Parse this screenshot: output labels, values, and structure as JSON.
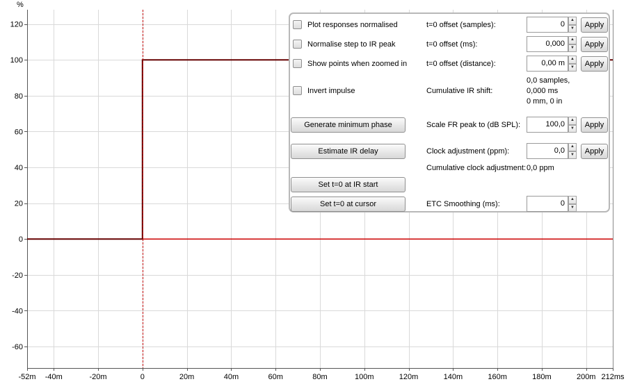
{
  "chart_data": {
    "type": "line",
    "ylabel": "%",
    "xlim": [
      -52,
      212
    ],
    "ylim": [
      -72,
      128
    ],
    "grid": true,
    "x_ticks": [
      -52,
      -40,
      -20,
      0,
      20,
      40,
      60,
      80,
      100,
      120,
      140,
      160,
      180,
      200,
      212
    ],
    "x_tick_labels": [
      "-52m",
      "-40m",
      "-20m",
      "0",
      "20m",
      "40m",
      "60m",
      "80m",
      "100m",
      "120m",
      "140m",
      "160m",
      "180m",
      "200m",
      "212ms"
    ],
    "y_ticks": [
      120,
      100,
      80,
      60,
      40,
      20,
      0,
      -20,
      -40,
      -60
    ],
    "y_tick_labels": [
      "120",
      "100",
      "80",
      "60",
      "40",
      "20",
      "0",
      "-20",
      "-40",
      "-60"
    ],
    "series": [
      {
        "color": "#660000",
        "x": [
          -52,
          0,
          0,
          212
        ],
        "y": [
          0,
          0,
          100,
          100
        ]
      },
      {
        "color": "#cc0000",
        "x": [
          -52,
          212
        ],
        "y": [
          0,
          0
        ]
      }
    ],
    "cursor_x": 0
  },
  "panel": {
    "options": [
      {
        "label": "Plot responses normalised",
        "checked": false
      },
      {
        "label": "Normalise step to IR peak",
        "checked": false
      },
      {
        "label": "Show points when zoomed in",
        "checked": false
      },
      {
        "label": "Invert impulse",
        "checked": false
      }
    ],
    "buttons": {
      "min_phase": "Generate minimum phase",
      "estimate_delay": "Estimate IR delay",
      "t0_ir_start": "Set t=0 at IR start",
      "t0_cursor": "Set t=0 at cursor"
    },
    "fields": {
      "offset_samples": {
        "label": "t=0 offset (samples):",
        "value": "0"
      },
      "offset_ms": {
        "label": "t=0 offset (ms):",
        "value": "0,000"
      },
      "offset_distance": {
        "label": "t=0 offset (distance):",
        "value": "0,00 m"
      },
      "scale_fr": {
        "label": "Scale FR peak to (dB SPL):",
        "value": "100,0"
      },
      "clock_adj": {
        "label": "Clock adjustment (ppm):",
        "value": "0,0"
      },
      "etc_smoothing": {
        "label": "ETC Smoothing (ms):",
        "value": "0"
      }
    },
    "cumulative_shift": {
      "label": "Cumulative IR shift:",
      "line1": "0,0 samples,",
      "line2": "0,000 ms",
      "line3": "0 mm, 0 in"
    },
    "cumulative_clock": {
      "label": "Cumulative clock adjustment:",
      "value": "0,0 ppm"
    },
    "apply_label": "Apply"
  }
}
